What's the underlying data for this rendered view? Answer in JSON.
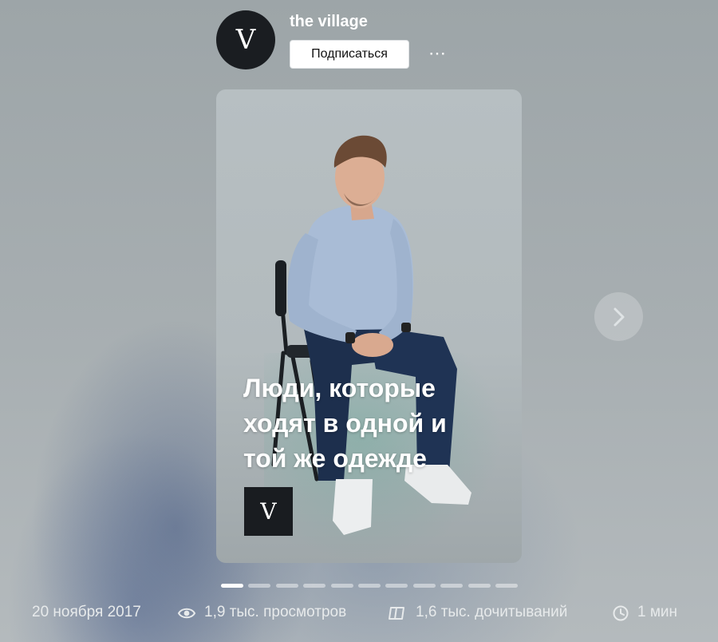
{
  "channel": {
    "name": "the village",
    "avatar_letter": "V",
    "subscribe_label": "Подписаться",
    "more_label": "⋯"
  },
  "story": {
    "title_lines": [
      "Люди, которые",
      "ходят в одной и",
      "той же одежде"
    ],
    "logo_letter": "V",
    "progress": {
      "total_pages": 11,
      "current_page": 1
    }
  },
  "stats": {
    "date": "20 ноября 2017",
    "views": "1,9 тыс. просмотров",
    "reads": "1,6 тыс. дочитываний",
    "read_time": "1 мин"
  },
  "icons": {
    "more": "more-dots-icon",
    "next": "chevron-right-icon",
    "views": "eye-icon",
    "reads": "book-open-icon",
    "time": "clock-icon"
  },
  "colors": {
    "avatar_bg": "#1a1d21",
    "subscribe_bg": "#ffffff",
    "stats_text": "#e7eaeb",
    "shirt": "#a9bcd6",
    "trousers": "#1d2f4d"
  }
}
